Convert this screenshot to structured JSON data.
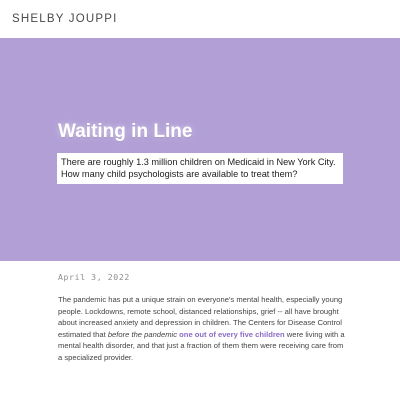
{
  "header": {
    "site_title": "SHELBY JOUPPI"
  },
  "hero": {
    "title": "Waiting in Line",
    "subtitle_line1": "There are roughly 1.3 million children on Medicaid in New York City.",
    "subtitle_line2": "How many child psychologists are available to treat them?",
    "background_color": "#b19fd6"
  },
  "article": {
    "date": "April 3, 2022",
    "paragraph": {
      "text_before_em": "The pandemic has put a unique strain on everyone's mental health, especially young people. Lockdowns, remote school, distanced relationships, grief -- all have brought about increased anxiety and depression in children. The Centers for Disease Control estimated that ",
      "em_text": "before the pandemic",
      "space": " ",
      "link_text": "one out of every five children",
      "text_after_link": " were living with a mental health disorder, and that just a fraction of them them were receiving care from a specialized provider.",
      "link_color": "#8b6cc4"
    }
  }
}
